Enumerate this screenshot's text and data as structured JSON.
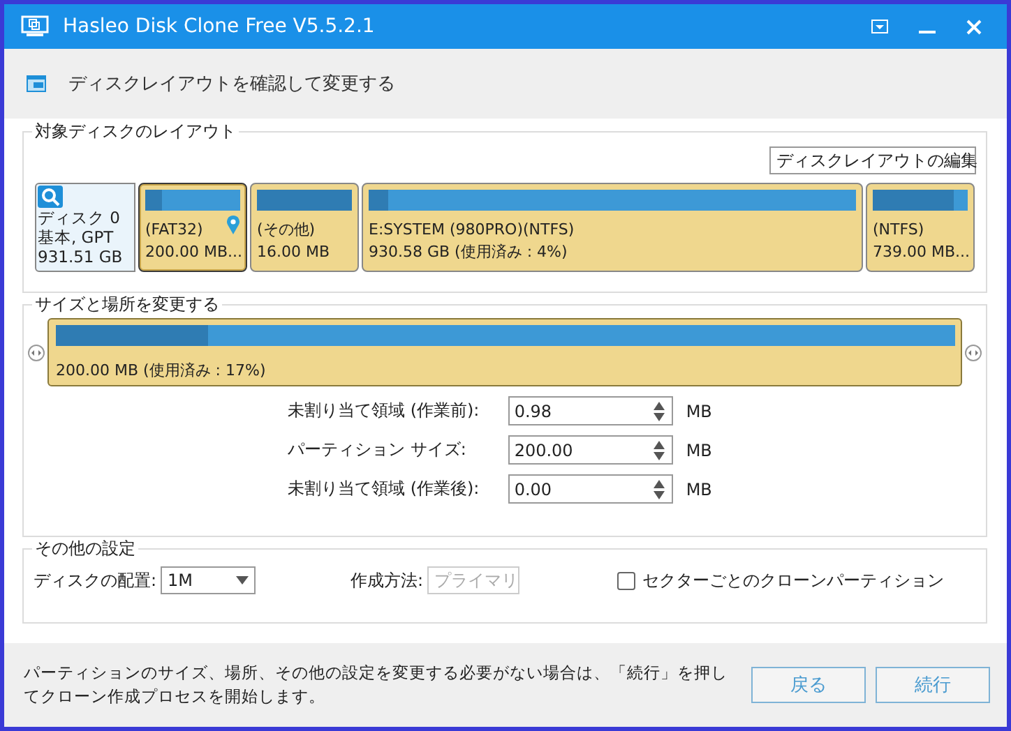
{
  "window": {
    "title": "Hasleo Disk Clone Free V5.5.2.1"
  },
  "header": {
    "title": "ディスクレイアウトを確認して変更する"
  },
  "target_layout": {
    "title": "対象ディスクのレイアウト",
    "edit_dropdown": {
      "value": "ディスクレイアウトの編集"
    },
    "disk": {
      "name": "ディスク 0",
      "type": "基本, GPT",
      "size": "931.51 GB"
    },
    "partitions": [
      {
        "fs": "(FAT32)",
        "size": "200.00 MB...",
        "level": 0.17,
        "selected": true
      },
      {
        "fs": "(その他)",
        "size": "16.00 MB",
        "level": 1.0,
        "selected": false
      },
      {
        "fs": "E:SYSTEM (980PRO)(NTFS)",
        "size": "930.58 GB (使用済み : 4%)",
        "level": 0.04,
        "selected": false
      },
      {
        "fs": "(NTFS)",
        "size": "739.00 MB...",
        "level": 0.86,
        "selected": false
      }
    ]
  },
  "resize": {
    "title": "サイズと場所を変更する",
    "bar": {
      "label": "200.00 MB (使用済み : 17%)",
      "level": 0.17
    },
    "fields": [
      {
        "label": "未割り当て領域 (作業前):",
        "value": "0.98",
        "unit": "MB"
      },
      {
        "label": "パーティション サイズ:",
        "value": "200.00",
        "unit": "MB"
      },
      {
        "label": "未割り当て領域 (作業後):",
        "value": "0.00",
        "unit": "MB"
      }
    ]
  },
  "other": {
    "title": "その他の設定",
    "alignment": {
      "label": "ディスクの配置:",
      "value": "1M",
      "disabled": false
    },
    "method": {
      "label": "作成方法:",
      "value": "プライマリ",
      "disabled": true
    },
    "sector_clone": {
      "label": "セクターごとのクローンパーティション",
      "checked": false
    }
  },
  "footer": {
    "message": "パーティションのサイズ、場所、その他の設定を変更する必要がない場合は、「続行」を押してクローン作成プロセスを開始します。",
    "buttons": [
      "戻る",
      "続行"
    ]
  }
}
